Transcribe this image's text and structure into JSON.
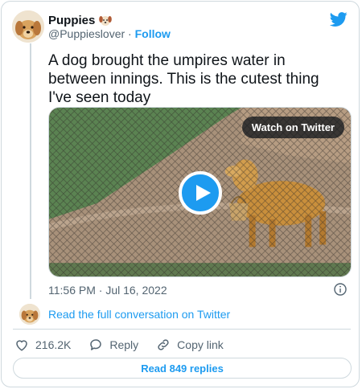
{
  "tweet": {
    "author_name": "Puppies",
    "handle": "@Puppieslover",
    "separator": "·",
    "follow_label": "Follow",
    "text": "A dog brought the umpires water in between innings. This is the cutest thing I've seen today",
    "timestamp": "11:56 PM · Jul 16, 2022",
    "conversation_link": "Read the full conversation on Twitter"
  },
  "media": {
    "watch_label": "Watch on Twitter"
  },
  "actions": {
    "likes": "216.2K",
    "reply_label": "Reply",
    "copy_label": "Copy link"
  },
  "replies_button": "Read 849 replies",
  "colors": {
    "accent": "#1d9bf0",
    "text": "#0f1419",
    "muted": "#536471",
    "border": "#cfd9de"
  }
}
